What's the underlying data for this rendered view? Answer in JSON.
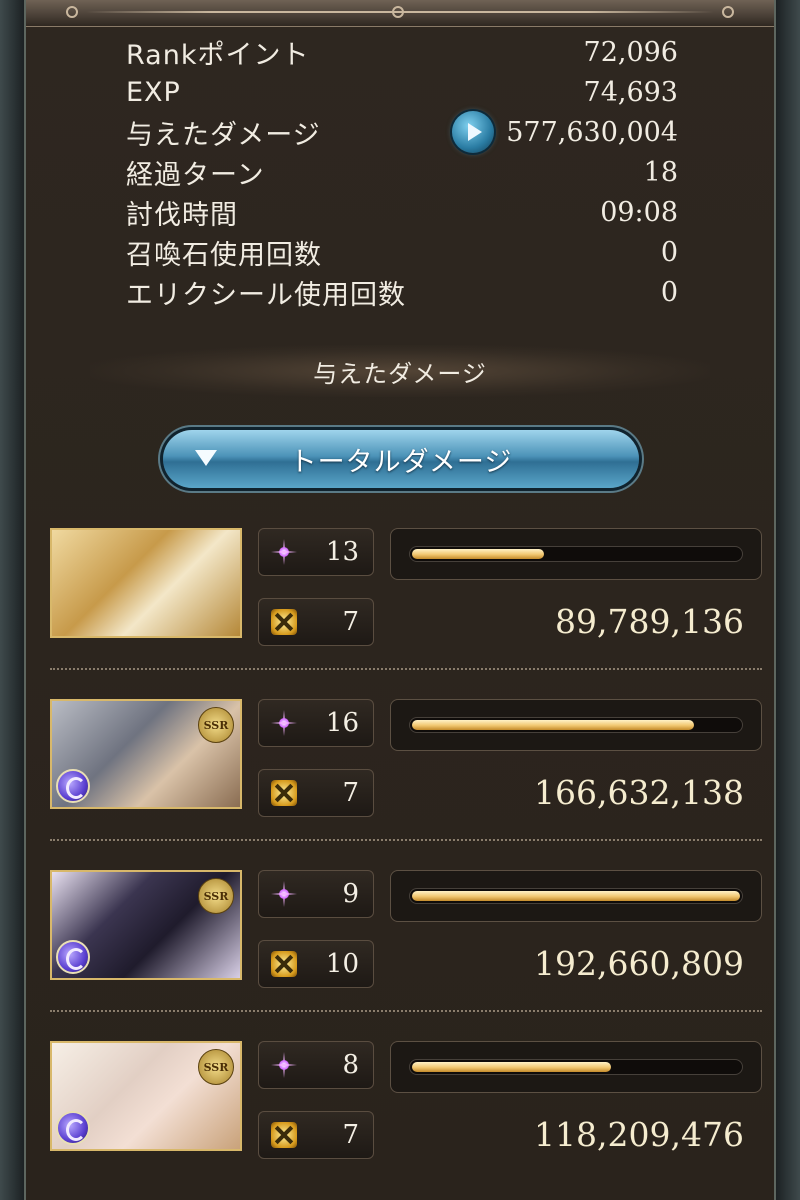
{
  "stats": [
    {
      "label": "Rankポイント",
      "value": "72,096"
    },
    {
      "label": "EXP",
      "value": "74,693"
    },
    {
      "label": "与えたダメージ",
      "value": "577,630,004",
      "has_button": true
    },
    {
      "label": "経過ターン",
      "value": "18"
    },
    {
      "label": "討伐時間",
      "value": "09:08"
    },
    {
      "label": "召喚石使用回数",
      "value": "0"
    },
    {
      "label": "エリクシール使用回数",
      "value": "0"
    }
  ],
  "section_title": "与えたダメージ",
  "dropdown": {
    "label": "トータルダメージ"
  },
  "characters": [
    {
      "ssr": false,
      "rarity_label": "",
      "portrait_color": "#d9b46a",
      "crits": "13",
      "ougi": "7",
      "bar_fraction": 0.41,
      "damage": "89,789,136"
    },
    {
      "ssr": true,
      "rarity_label": "SSR",
      "portrait_color": "#8b8f99",
      "crits": "16",
      "ougi": "7",
      "bar_fraction": 0.86,
      "damage": "166,632,138"
    },
    {
      "ssr": true,
      "rarity_label": "SSR",
      "portrait_color": "#4b4466",
      "crits": "9",
      "ougi": "10",
      "bar_fraction": 1.0,
      "damage": "192,660,809"
    },
    {
      "ssr": true,
      "rarity_label": "SSR",
      "portrait_color": "#e8d8cc",
      "crits": "8",
      "ougi": "7",
      "bar_fraction": 0.61,
      "damage": "118,209,476"
    }
  ]
}
